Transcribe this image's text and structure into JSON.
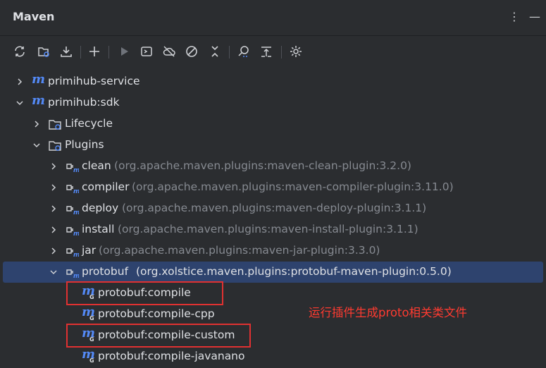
{
  "panel": {
    "title": "Maven"
  },
  "toolbar": {
    "icons": [
      "reload-icon",
      "reimport-icon",
      "download-icon",
      "add-icon",
      "run-icon",
      "execute-goal-icon",
      "offline-icon",
      "skip-tests-icon",
      "collapse-icon",
      "analyze-icon",
      "expand-icon",
      "settings-icon"
    ]
  },
  "tree": {
    "service": "primihub-service",
    "sdk": "primihub:sdk",
    "lifecycle": "Lifecycle",
    "plugins": "Plugins",
    "plugin_items": [
      {
        "name": "clean",
        "coord": "(org.apache.maven.plugins:maven-clean-plugin:3.2.0)"
      },
      {
        "name": "compiler",
        "coord": "(org.apache.maven.plugins:maven-compiler-plugin:3.11.0)"
      },
      {
        "name": "deploy",
        "coord": "(org.apache.maven.plugins:maven-deploy-plugin:3.1.1)"
      },
      {
        "name": "install",
        "coord": "(org.apache.maven.plugins:maven-install-plugin:3.1.1)"
      },
      {
        "name": "jar",
        "coord": "(org.apache.maven.plugins:maven-jar-plugin:3.3.0)"
      },
      {
        "name": "protobuf",
        "coord": "(org.xolstice.maven.plugins:protobuf-maven-plugin:0.5.0)"
      }
    ],
    "goals": [
      "protobuf:compile",
      "protobuf:compile-cpp",
      "protobuf:compile-custom",
      "protobuf:compile-javanano"
    ]
  },
  "annotation": {
    "text": "运行插件生成proto相关类文件",
    "color": "#ff3b30"
  },
  "colors": {
    "background": "#2b2d30",
    "selection": "#2e436e",
    "maven_blue": "#548af7",
    "highlight_box": "#e03131"
  }
}
